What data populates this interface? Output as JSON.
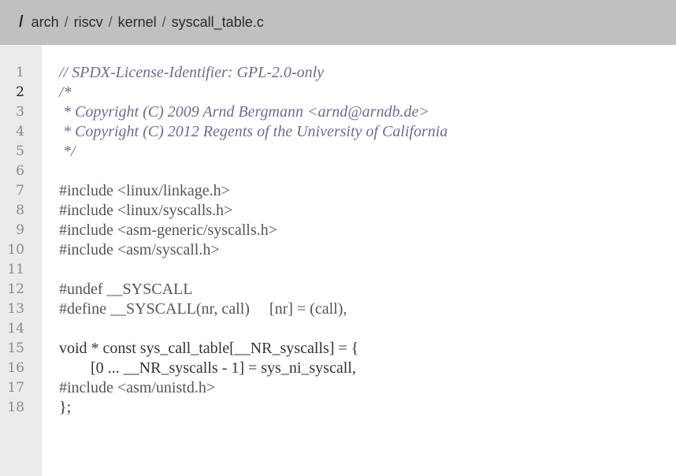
{
  "breadcrumb": {
    "root": "/",
    "parts": [
      "arch",
      "riscv",
      "kernel"
    ],
    "separator": "/",
    "current": "syscall_table.c"
  },
  "editor": {
    "active_line": 2,
    "line_numbers": [
      "1",
      "2",
      "3",
      "4",
      "5",
      "6",
      "7",
      "8",
      "9",
      "10",
      "11",
      "12",
      "13",
      "14",
      "15",
      "16",
      "17",
      "18"
    ],
    "lines": [
      "// SPDX-License-Identifier: GPL-2.0-only",
      "/*",
      " * Copyright (C) 2009 Arnd Bergmann <arnd@arndb.de>",
      " * Copyright (C) 2012 Regents of the University of California",
      " */",
      "",
      "#include <linux/linkage.h>",
      "#include <linux/syscalls.h>",
      "#include <asm-generic/syscalls.h>",
      "#include <asm/syscall.h>",
      "",
      "#undef __SYSCALL",
      "#define __SYSCALL(nr, call)     [nr] = (call),",
      "",
      "void * const sys_call_table[__NR_syscalls] = {",
      "        [0 ... __NR_syscalls - 1] = sys_ni_syscall,",
      "#include <asm/unistd.h>",
      "};"
    ]
  },
  "colors": {
    "breadcrumb_bg": "#c0c0c0",
    "gutter_bg": "#ebebeb",
    "editor_bg": "#ffffff",
    "comment": "#6a6e8a"
  }
}
